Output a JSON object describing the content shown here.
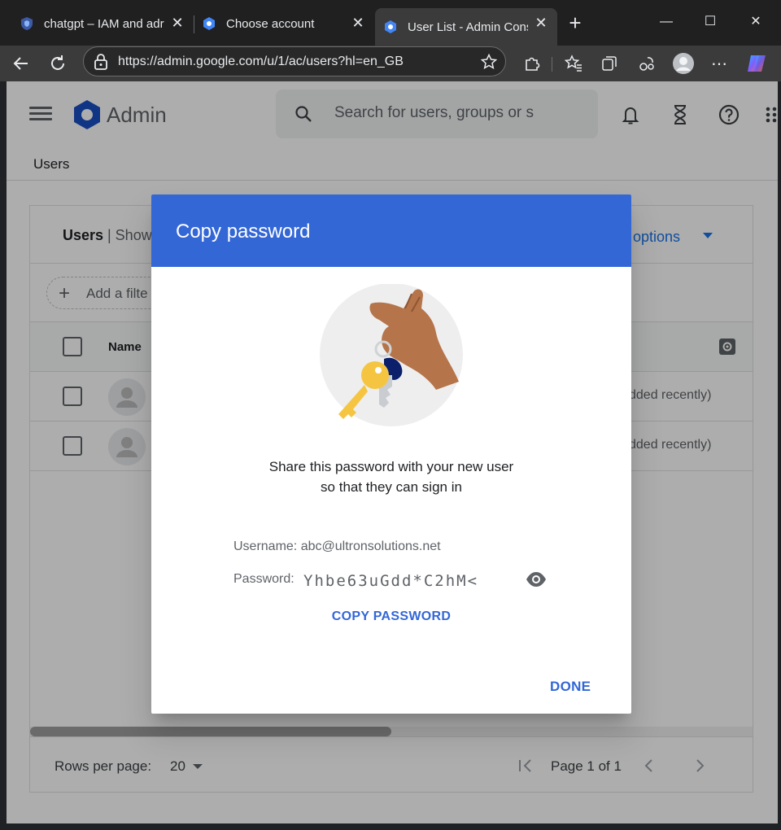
{
  "browser": {
    "tabs": [
      {
        "title": "chatgpt – IAM and adr",
        "close": "✕",
        "active": false
      },
      {
        "title": "Choose account",
        "close": "✕",
        "active": false
      },
      {
        "title": "User List - Admin Cons",
        "close": "✕",
        "active": true
      }
    ],
    "new_tab_icon": "plus-icon",
    "url": "https://admin.google.com/u/1/ac/users?hl=en_GB",
    "window_controls": {
      "minimize": "—",
      "maximize": "☐",
      "close": "✕"
    }
  },
  "app": {
    "title": "Admin",
    "search_placeholder": "Search for users, groups or s",
    "breadcrumb": "Users"
  },
  "users_card": {
    "title": "Users",
    "subtitle": "| Show",
    "more_options": "re options",
    "add_filter": "Add a filte",
    "columns": {
      "name": "Name"
    },
    "rows": [
      {
        "status": "dded recently)"
      },
      {
        "status": "dded recently)"
      }
    ],
    "scroll_fraction": 0.5,
    "pager": {
      "rows_per_page_label": "Rows per page:",
      "rows_per_page_value": "20",
      "page_label": "Page 1 of 1"
    }
  },
  "dialog": {
    "title": "Copy password",
    "message_line1": "Share this password with your new user",
    "message_line2": "so that they can sign in",
    "username_line": "Username: abc@ultronsolutions.net",
    "password_label": "Password:",
    "password_value": "Yhbe63uGdd*C2hM<",
    "copy_button": "COPY PASSWORD",
    "done_button": "DONE"
  },
  "colors": {
    "dialog_header": "#3367d6",
    "link_blue": "#3367d6",
    "browser_frame": "#202020"
  }
}
